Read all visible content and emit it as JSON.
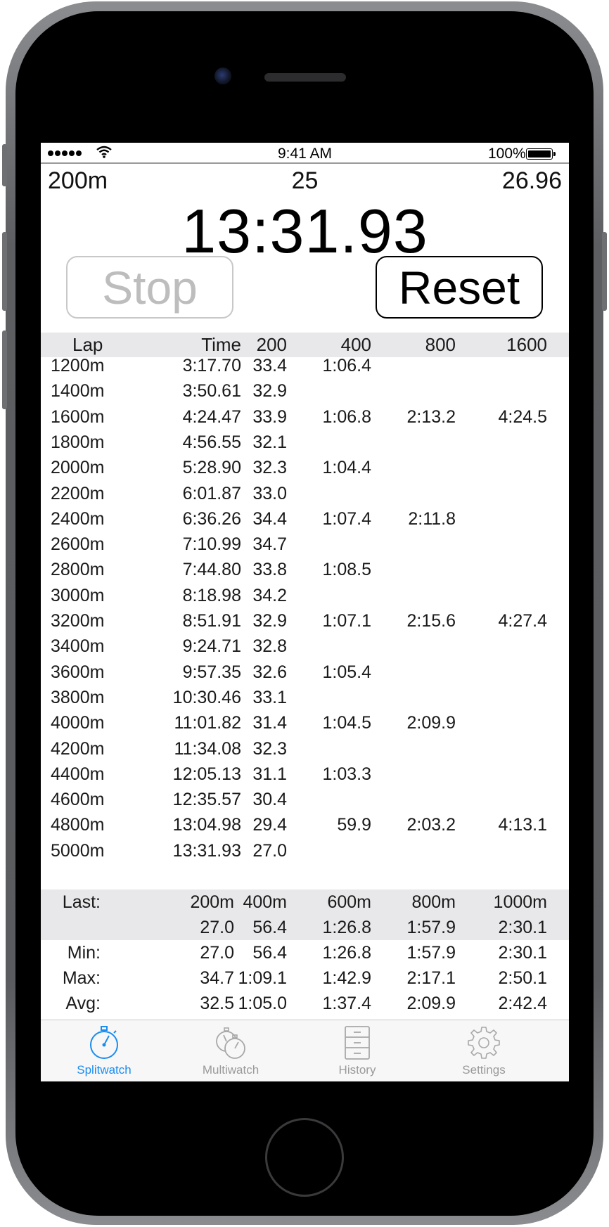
{
  "status_bar": {
    "time": "9:41 AM",
    "battery": "100%"
  },
  "header": {
    "interval": "200m",
    "lap_count": "25",
    "current_split": "26.96",
    "elapsed": "13:31.93"
  },
  "controls": {
    "stop_label": "Stop",
    "reset_label": "Reset"
  },
  "table": {
    "columns": [
      "Lap",
      "Time",
      "200",
      "400",
      "800",
      "1600"
    ],
    "rows": [
      [
        "1200m",
        "3:17.70",
        "33.4",
        "1:06.4",
        "",
        ""
      ],
      [
        "1400m",
        "3:50.61",
        "32.9",
        "",
        "",
        ""
      ],
      [
        "1600m",
        "4:24.47",
        "33.9",
        "1:06.8",
        "2:13.2",
        "4:24.5"
      ],
      [
        "1800m",
        "4:56.55",
        "32.1",
        "",
        "",
        ""
      ],
      [
        "2000m",
        "5:28.90",
        "32.3",
        "1:04.4",
        "",
        ""
      ],
      [
        "2200m",
        "6:01.87",
        "33.0",
        "",
        "",
        ""
      ],
      [
        "2400m",
        "6:36.26",
        "34.4",
        "1:07.4",
        "2:11.8",
        ""
      ],
      [
        "2600m",
        "7:10.99",
        "34.7",
        "",
        "",
        ""
      ],
      [
        "2800m",
        "7:44.80",
        "33.8",
        "1:08.5",
        "",
        ""
      ],
      [
        "3000m",
        "8:18.98",
        "34.2",
        "",
        "",
        ""
      ],
      [
        "3200m",
        "8:51.91",
        "32.9",
        "1:07.1",
        "2:15.6",
        "4:27.4"
      ],
      [
        "3400m",
        "9:24.71",
        "32.8",
        "",
        "",
        ""
      ],
      [
        "3600m",
        "9:57.35",
        "32.6",
        "1:05.4",
        "",
        ""
      ],
      [
        "3800m",
        "10:30.46",
        "33.1",
        "",
        "",
        ""
      ],
      [
        "4000m",
        "11:01.82",
        "31.4",
        "1:04.5",
        "2:09.9",
        ""
      ],
      [
        "4200m",
        "11:34.08",
        "32.3",
        "",
        "",
        ""
      ],
      [
        "4400m",
        "12:05.13",
        "31.1",
        "1:03.3",
        "",
        ""
      ],
      [
        "4600m",
        "12:35.57",
        "30.4",
        "",
        "",
        ""
      ],
      [
        "4800m",
        "13:04.98",
        "29.4",
        "59.9",
        "2:03.2",
        "4:13.1"
      ],
      [
        "5000m",
        "13:31.93",
        "27.0",
        "",
        "",
        ""
      ]
    ]
  },
  "stats": {
    "last_label": "Last:",
    "distances": [
      "200m",
      "400m",
      "600m",
      "800m",
      "1000m"
    ],
    "last": [
      "27.0",
      "56.4",
      "1:26.8",
      "1:57.9",
      "2:30.1"
    ],
    "min_label": "Min:",
    "min": [
      "27.0",
      "56.4",
      "1:26.8",
      "1:57.9",
      "2:30.1"
    ],
    "max_label": "Max:",
    "max": [
      "34.7",
      "1:09.1",
      "1:42.9",
      "2:17.1",
      "2:50.1"
    ],
    "avg_label": "Avg:",
    "avg": [
      "32.5",
      "1:05.0",
      "1:37.4",
      "2:09.9",
      "2:42.4"
    ]
  },
  "tabs": [
    {
      "label": "Splitwatch",
      "icon": "stopwatch-icon",
      "active": true
    },
    {
      "label": "Multiwatch",
      "icon": "multi-stopwatch-icon",
      "active": false
    },
    {
      "label": "History",
      "icon": "file-cabinet-icon",
      "active": false
    },
    {
      "label": "Settings",
      "icon": "gear-icon",
      "active": false
    }
  ],
  "colors": {
    "accent": "#1a8cf0",
    "header_bg": "#e8e8ea",
    "disabled": "#bdbdbd"
  }
}
